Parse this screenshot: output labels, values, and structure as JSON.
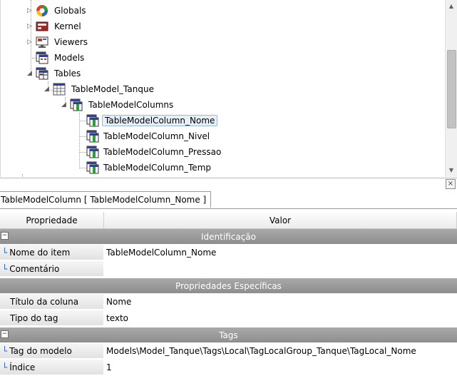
{
  "tree": {
    "items": [
      {
        "label": "Globals",
        "icon": "globals-icon",
        "expander": "collapsed"
      },
      {
        "label": "Kernel",
        "icon": "kernel-icon",
        "expander": "collapsed"
      },
      {
        "label": "Viewers",
        "icon": "viewers-icon",
        "expander": "collapsed"
      },
      {
        "label": "Models",
        "icon": "models-icon",
        "expander": "none"
      },
      {
        "label": "Tables",
        "icon": "tables-icon",
        "expander": "expanded"
      },
      {
        "label": "TableModel_Tanque",
        "icon": "table-model-icon",
        "expander": "expanded"
      },
      {
        "label": "TableModelColumns",
        "icon": "table-columns-icon",
        "expander": "expanded"
      },
      {
        "label": "TableModelColumn_Nome",
        "icon": "table-column-icon",
        "selected": true
      },
      {
        "label": "TableModelColumn_Nivel",
        "icon": "table-column-icon"
      },
      {
        "label": "TableModelColumn_Pressao",
        "icon": "table-column-icon"
      },
      {
        "label": "TableModelColumn_Temp",
        "icon": "table-column-icon"
      }
    ]
  },
  "panel": {
    "tab_title": "TableModelColumn [ TableModelColumn_Nome ]",
    "close_label": "×"
  },
  "grid": {
    "col_property": "Propriedade",
    "col_value": "Valor",
    "sections": [
      {
        "title": "Identificação",
        "rows": [
          {
            "name": "Nome do item",
            "value": "TableModelColumn_Nome"
          },
          {
            "name": "Comentário",
            "value": ""
          }
        ]
      },
      {
        "title": "Propriedades Específicas",
        "rows": [
          {
            "name": "Título da coluna",
            "value": "Nome"
          },
          {
            "name": "Tipo do tag",
            "value": "texto"
          }
        ]
      },
      {
        "title": "Tags",
        "rows": [
          {
            "name": "Tag do modelo",
            "value": "Models\\Model_Tanque\\Tags\\Local\\TagLocalGroup_Tanque\\TagLocal_Nome"
          },
          {
            "name": "Índice",
            "value": "1"
          }
        ]
      }
    ]
  },
  "colors": {
    "section_bg": "#9c9c9c",
    "selection_bg": "#e6f0fb",
    "selection_border": "#98b8de"
  }
}
